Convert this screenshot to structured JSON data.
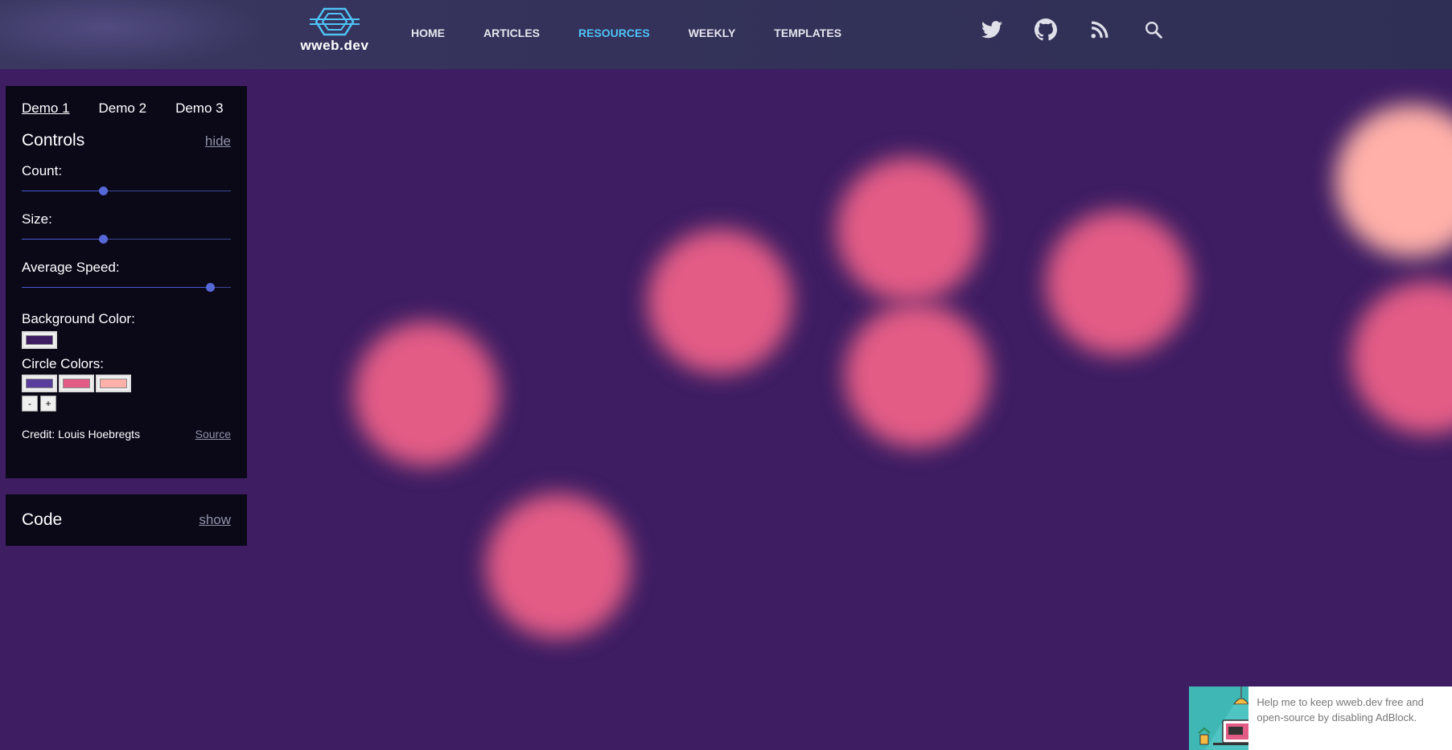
{
  "header": {
    "logo_text": "wweb.dev",
    "nav": [
      {
        "label": "HOME",
        "active": false
      },
      {
        "label": "ARTICLES",
        "active": false
      },
      {
        "label": "RESOURCES",
        "active": true
      },
      {
        "label": "WEEKLY",
        "active": false
      },
      {
        "label": "TEMPLATES",
        "active": false
      }
    ],
    "icons": [
      "twitter-icon",
      "github-icon",
      "rss-icon",
      "search-icon"
    ]
  },
  "controls": {
    "tabs": [
      "Demo 1",
      "Demo 2",
      "Demo 3"
    ],
    "active_tab": "Demo 1",
    "title": "Controls",
    "hide_label": "hide",
    "count_label": "Count:",
    "count_value": 0.39,
    "size_label": "Size:",
    "size_value": 0.39,
    "speed_label": "Average Speed:",
    "speed_value": 0.9,
    "bg_color_label": "Background Color:",
    "bg_color": "#3e1d63",
    "circle_colors_label": "Circle Colors:",
    "circle_colors": [
      "#5a3c9c",
      "#e35c86",
      "#ffb0a8"
    ],
    "minus_label": "-",
    "plus_label": "+",
    "credit": "Credit: Louis Hoebregts",
    "source_label": "Source"
  },
  "code": {
    "title": "Code",
    "show_label": "show"
  },
  "ad": {
    "text": "Help me to keep wweb.dev free and open-source by disabling AdBlock."
  },
  "colors": {
    "background": "#3e1d63",
    "circle_pink": "#e35c86",
    "circle_light": "#ffb0a8",
    "nav_active": "#4fc3f7"
  }
}
